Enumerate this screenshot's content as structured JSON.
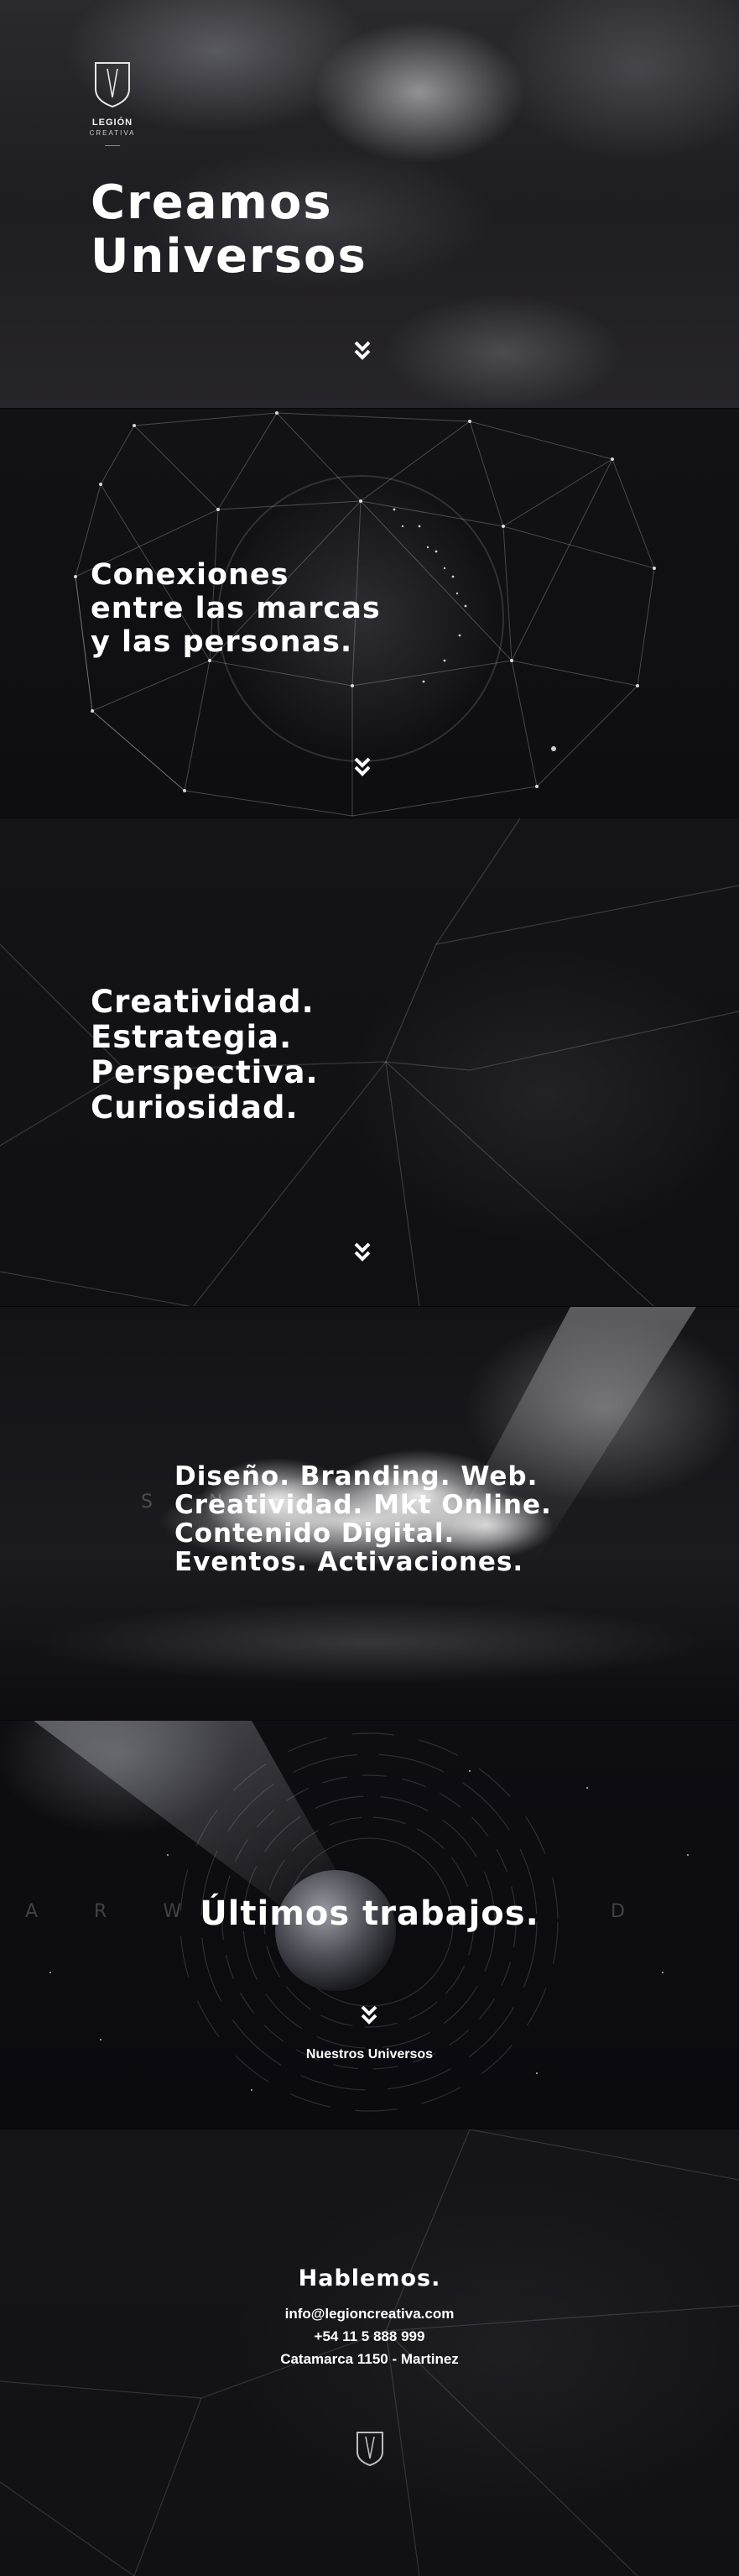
{
  "brand": {
    "name": "LEGIÓN",
    "sub": "CREATIVA"
  },
  "hero": {
    "line1": "Creamos",
    "line2": "Universos"
  },
  "section2": {
    "line1": "Conexiones",
    "line2": "entre las marcas",
    "line3": "y las personas."
  },
  "section3": {
    "line1": "Creatividad.",
    "line2": "Estrategia.",
    "line3": "Perspectiva.",
    "line4": "Curiosidad."
  },
  "section4": {
    "line1": "Diseño. Branding. Web.",
    "line2": "Creatividad. Mkt Online.",
    "line3": "Contenido Digital.",
    "line4": "Eventos. Activaciones.",
    "ghost": "S N"
  },
  "section5": {
    "title": "Últimos trabajos.",
    "link": "Nuestros Universos",
    "ghost_left": "A R W",
    "ghost_right": "D"
  },
  "contact": {
    "title": "Hablemos.",
    "email": "info@legioncreativa.com",
    "phone": "+54 11 5 888 999",
    "address": "Catamarca 1150 - Martinez"
  },
  "icons": {
    "logo": "shield-logo-icon",
    "scroll": "double-chevron-down-icon"
  },
  "colors": {
    "text": "#ffffff",
    "background": "#0b0b0d"
  }
}
